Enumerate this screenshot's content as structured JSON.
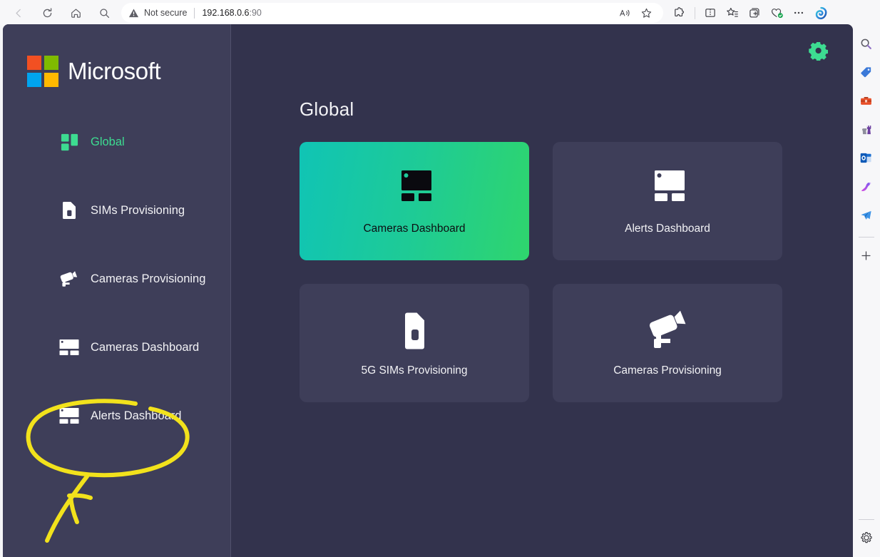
{
  "browser": {
    "nav": [
      {
        "name": "back",
        "glyph": "back-arrow-icon",
        "disabled": true
      },
      {
        "name": "refresh",
        "glyph": "refresh-icon",
        "disabled": false
      },
      {
        "name": "home",
        "glyph": "home-icon",
        "disabled": false
      },
      {
        "name": "search",
        "glyph": "search-icon",
        "disabled": false
      }
    ],
    "address": {
      "security_label": "Not secure",
      "security_icon": "warning-triangle-icon",
      "url_host": "192.168.0.6",
      "url_port": ":90",
      "read_aloud_icon": "read-aloud-icon",
      "favorite_icon": "star-outline-icon"
    },
    "toolbar_icons": [
      {
        "name": "extensions-icon",
        "glyph": "❖"
      },
      {
        "name": "split-screen-icon",
        "glyph": "◫"
      },
      {
        "name": "favorites-icon",
        "glyph": "☆"
      },
      {
        "name": "collections-icon",
        "glyph": "⊞"
      },
      {
        "name": "browser-essentials-icon",
        "glyph": "♡"
      },
      {
        "name": "settings-and-more-icon",
        "glyph": "···"
      },
      {
        "name": "copilot-icon",
        "glyph": "◕"
      }
    ],
    "edge_sidebar": [
      {
        "name": "search-icon",
        "glyph": "🔍"
      },
      {
        "name": "shopping-tag-icon",
        "glyph": "🏷"
      },
      {
        "name": "tools-toolbox-icon",
        "glyph": "🧰"
      },
      {
        "name": "games-icon",
        "glyph": "♜"
      },
      {
        "name": "outlook-icon",
        "glyph": "✉"
      },
      {
        "name": "image-creator-icon",
        "glyph": "🦩"
      },
      {
        "name": "drop-icon",
        "glyph": "➤"
      },
      {
        "name": "add-sidebar-app-icon",
        "glyph": "+"
      }
    ],
    "edge_sidebar_bottom": {
      "name": "sidebar-settings-icon",
      "glyph": "⚙"
    }
  },
  "app": {
    "brand": {
      "word": "Microsoft",
      "logo_colors": [
        "#f25022",
        "#7fba00",
        "#00a4ef",
        "#ffb900"
      ]
    },
    "sidebar": {
      "items": [
        {
          "label": "Global",
          "icon": "grid-dashboard-icon",
          "active": true
        },
        {
          "label": "SIMs Provisioning",
          "icon": "sim-card-icon",
          "active": false
        },
        {
          "label": "Cameras Provisioning",
          "icon": "security-camera-icon",
          "active": false
        },
        {
          "label": "Cameras Dashboard",
          "icon": "dashboard-layout-icon",
          "active": false
        },
        {
          "label": "Alerts Dashboard",
          "icon": "dashboard-layout-icon",
          "active": false
        }
      ]
    },
    "header": {
      "settings_icon": "gear-icon",
      "settings_color": "#3ddc91"
    },
    "main": {
      "title": "Global",
      "cards": [
        {
          "label": "Cameras Dashboard",
          "icon": "dashboard-layout-icon",
          "active": true
        },
        {
          "label": "Alerts Dashboard",
          "icon": "dashboard-layout-icon",
          "active": false
        },
        {
          "label": "5G SIMs Provisioning",
          "icon": "sim-card-icon",
          "active": false
        },
        {
          "label": "Cameras Provisioning",
          "icon": "security-camera-icon",
          "active": false
        }
      ]
    },
    "annotation": {
      "type": "handwritten-highlight",
      "color": "#f2e21c",
      "shapes": [
        "ellipse-around-alerts-dashboard",
        "arrow-pointing-up"
      ],
      "target": "Alerts Dashboard"
    },
    "colors": {
      "content_bg": "#33334d",
      "sidebar_bg": "#3e3e59",
      "card_bg": "#3e3e59",
      "accent_green": "#3ddc91",
      "gradient_from": "#10c4b5",
      "gradient_to": "#2fd56d"
    }
  }
}
